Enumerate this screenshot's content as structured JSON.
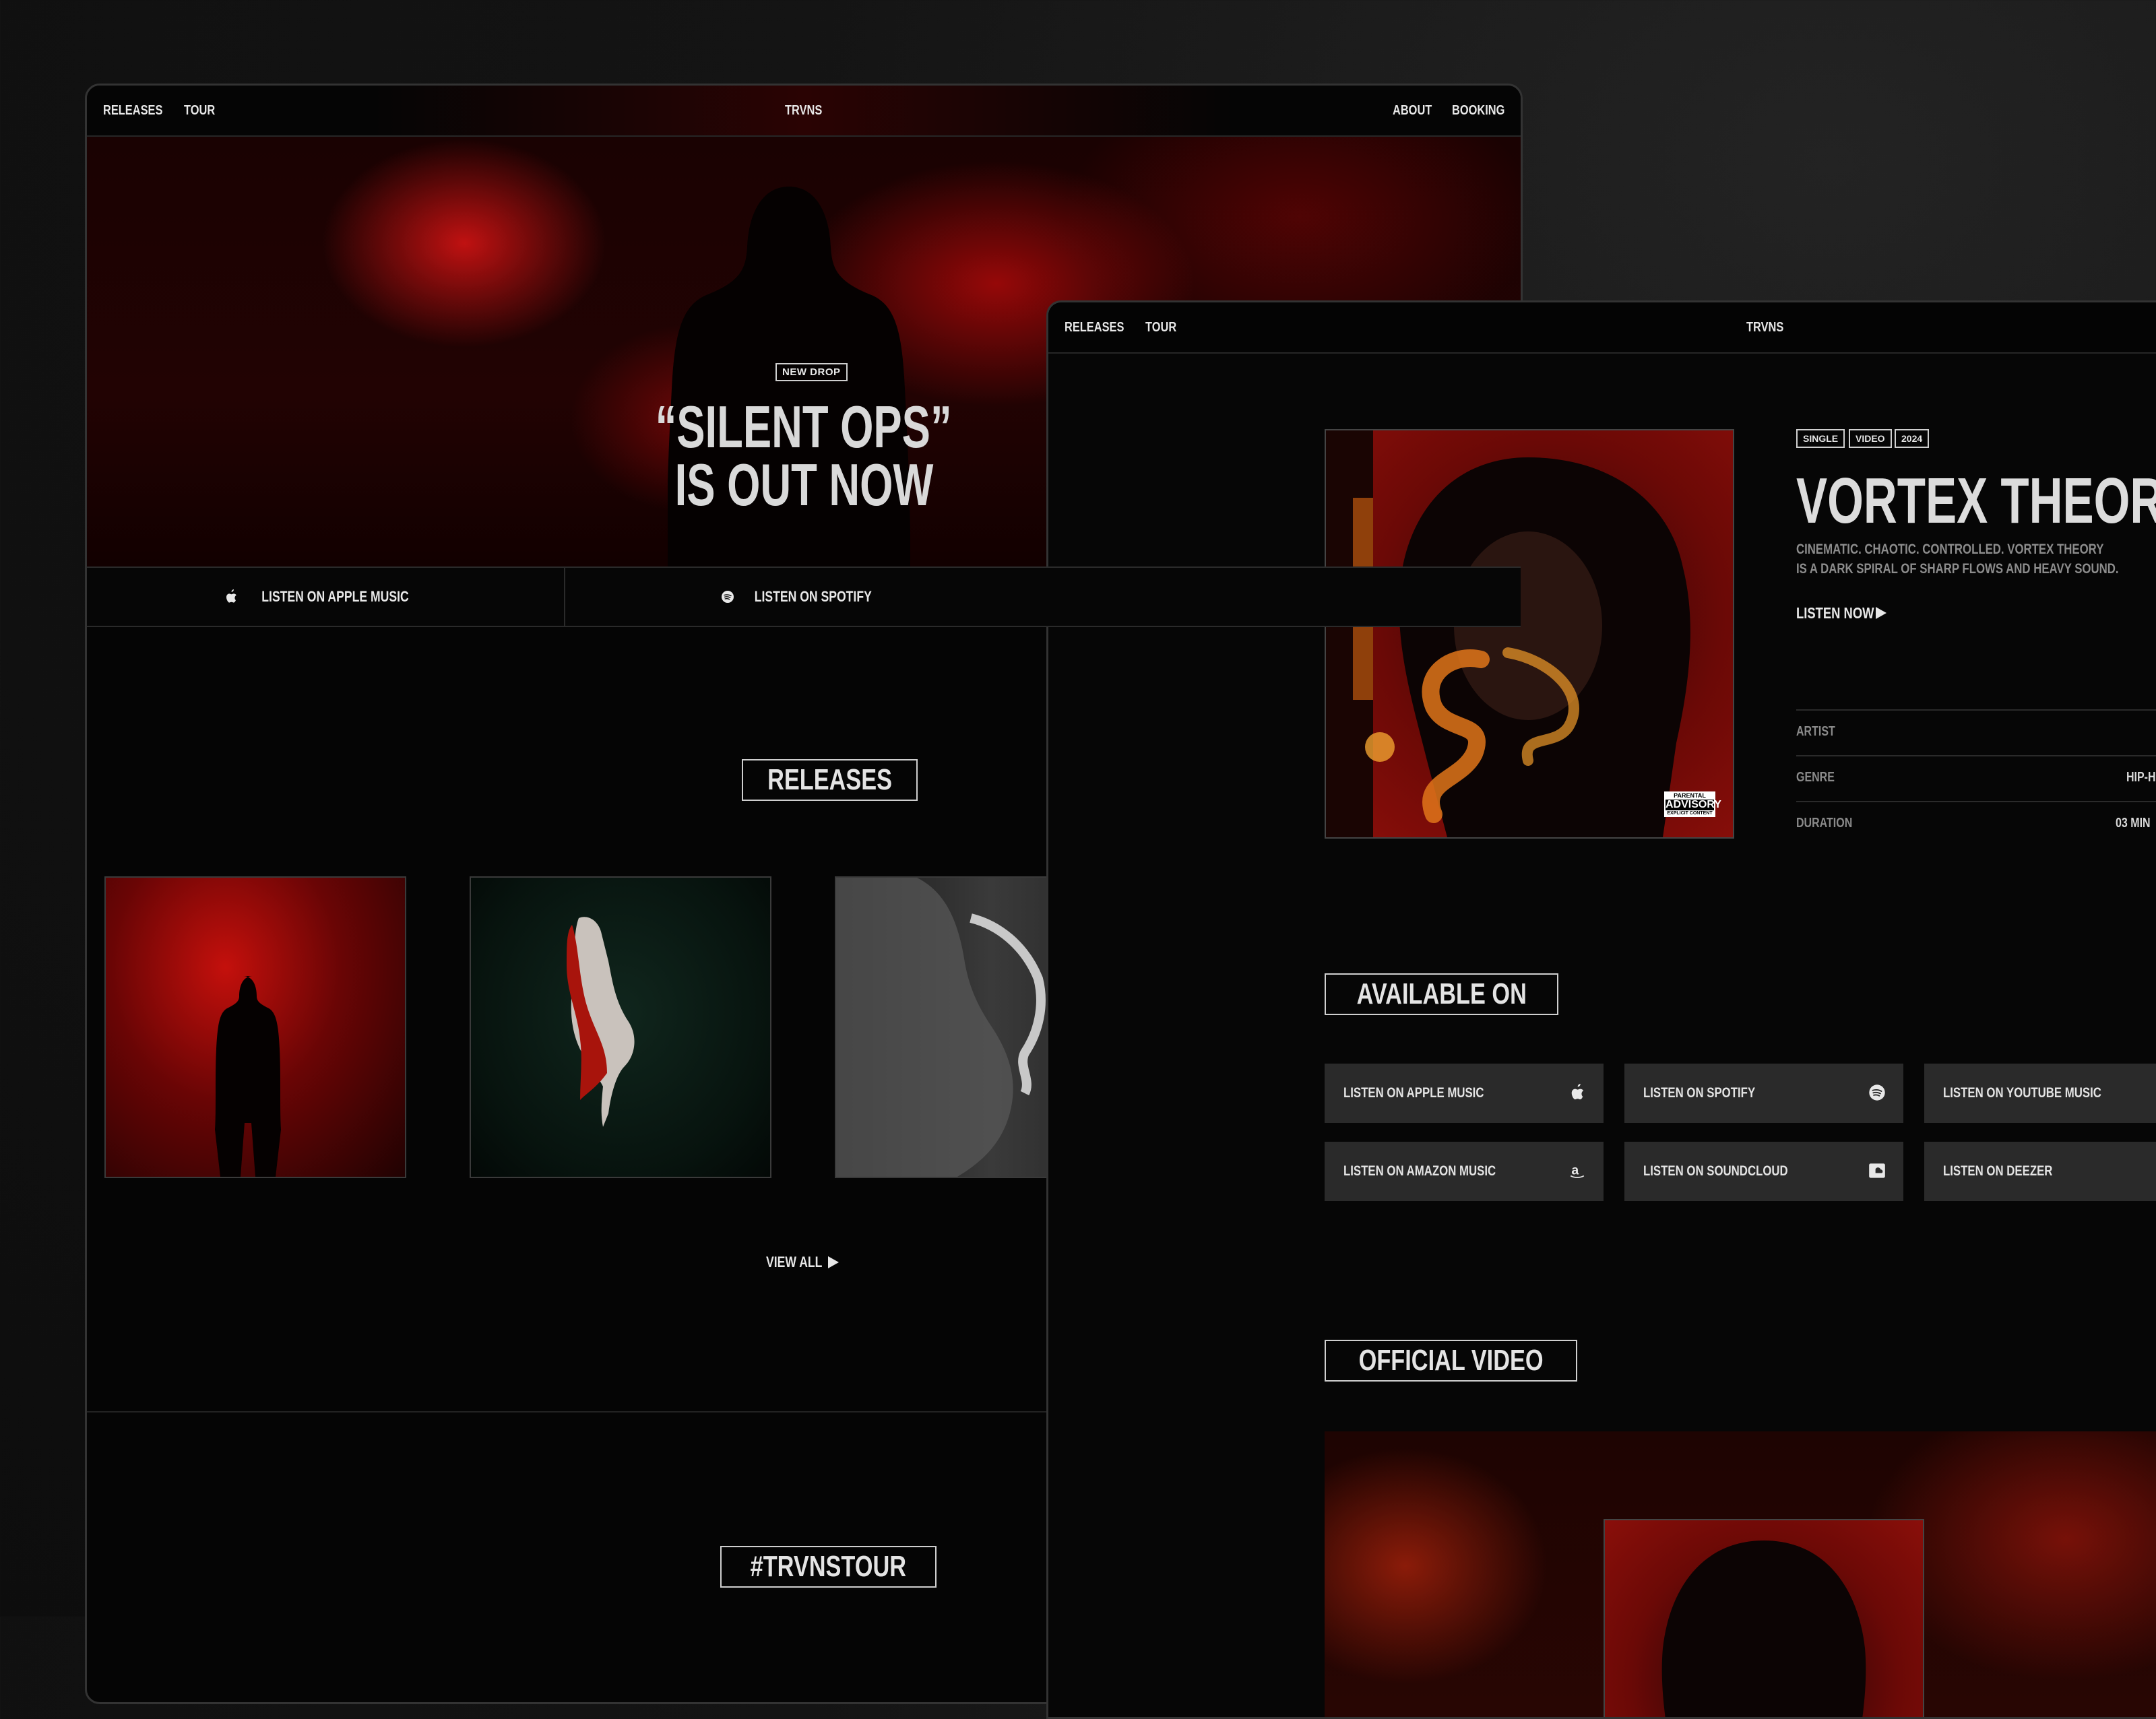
{
  "colors": {
    "accent": "#c0100c",
    "background": "#050505",
    "service_button": "#2a2a2a"
  },
  "back": {
    "nav": {
      "releases": "RELEASES",
      "tour": "TOUR",
      "logo": "TRVNS",
      "about": "ABOUT",
      "booking": "BOOKING"
    },
    "hero": {
      "badge": "NEW DROP",
      "title_line1": "“SILENT OPS”",
      "title_line2": "IS OUT NOW"
    },
    "listen": {
      "apple": "LISTEN ON APPLE MUSIC",
      "spotify": "LISTEN ON SPOTIFY"
    },
    "releases": {
      "title": "RELEASES",
      "view_all": "VIEW ALL"
    },
    "tour": {
      "title": "#TRVNSTOUR"
    }
  },
  "front": {
    "nav": {
      "releases": "RELEASES",
      "tour": "TOUR",
      "logo": "TRVNS"
    },
    "tags": [
      "SINGLE",
      "VIDEO",
      "2024"
    ],
    "title": "VORTEX THEORY",
    "desc_line1": "CINEMATIC. CHAOTIC. CONTROLLED. VORTEX THEORY",
    "desc_line2": "IS A DARK SPIRAL OF SHARP FLOWS AND HEAVY SOUND.",
    "listen_now": "LISTEN NOW",
    "advisory": {
      "line1": "PARENTAL",
      "line2": "ADVISORY",
      "line3": "EXPLICIT CONTENT"
    },
    "meta": [
      {
        "key": "ARTIST",
        "value": ""
      },
      {
        "key": "GENRE",
        "value": "HIP-H"
      },
      {
        "key": "DURATION",
        "value": "03 MIN"
      }
    ],
    "available_title": "AVAILABLE ON",
    "services": [
      {
        "label": "LISTEN ON APPLE MUSIC",
        "icon": "apple-icon"
      },
      {
        "label": "LISTEN ON SPOTIFY",
        "icon": "spotify-icon"
      },
      {
        "label": "LISTEN ON YOUTUBE MUSIC",
        "icon": "youtube-music-icon"
      },
      {
        "label": "LISTEN ON AMAZON MUSIC",
        "icon": "amazon-icon"
      },
      {
        "label": "LISTEN ON SOUNDCLOUD",
        "icon": "soundcloud-icon"
      },
      {
        "label": "LISTEN ON DEEZER",
        "icon": "deezer-icon"
      }
    ],
    "video_title": "OFFICIAL VIDEO"
  }
}
